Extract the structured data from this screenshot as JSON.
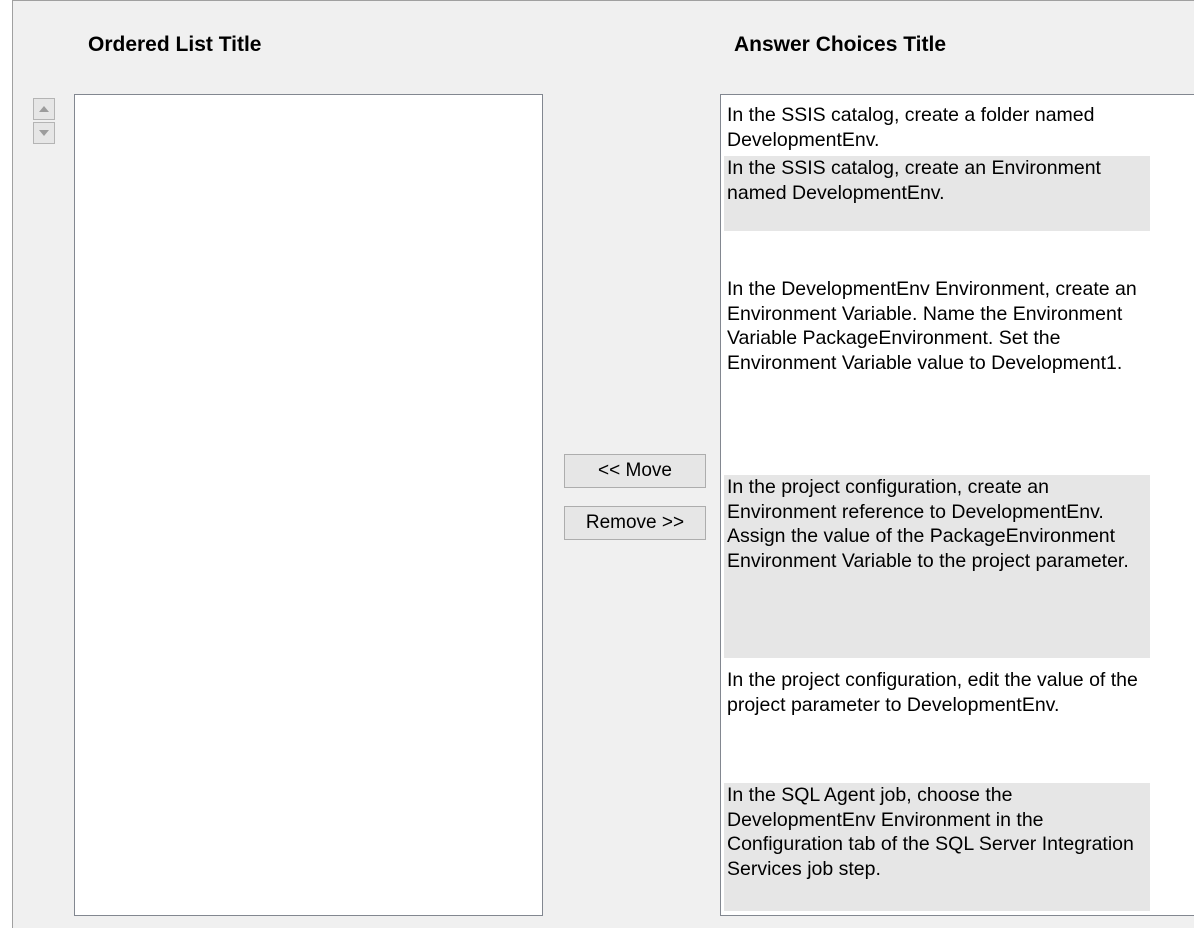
{
  "ordered_list": {
    "title": "Ordered List Title",
    "items": []
  },
  "answer_choices": {
    "title": "Answer Choices Title",
    "items": [
      "In the SSIS catalog, create a folder named DevelopmentEnv.",
      "In the SSIS catalog, create an Environment named DevelopmentEnv.",
      "In the DevelopmentEnv Environment, create an Environment Variable. Name the Environment Variable PackageEnvironment. Set the Environment Variable value to Development1.",
      "In the project configuration, create an Environment reference to DevelopmentEnv. Assign the value of the PackageEnvironment Environment Variable to the project parameter.",
      "In the project configuration, edit the value of the project parameter to DevelopmentEnv.",
      "In the SQL Agent job, choose the DevelopmentEnv Environment in the Configuration tab of the SQL Server Integration Services job step."
    ]
  },
  "buttons": {
    "move_label": "<< Move",
    "remove_label": "Remove >>"
  },
  "icons": {
    "up": "arrow-up-icon",
    "down": "arrow-down-icon"
  }
}
